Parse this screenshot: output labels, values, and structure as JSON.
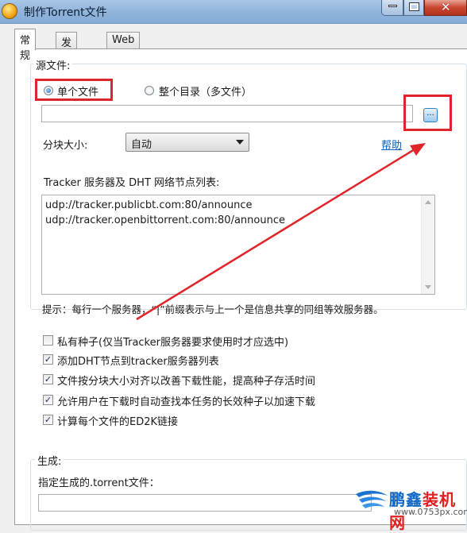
{
  "window": {
    "title": "制作Torrent文件",
    "controls": {
      "minimize": "—",
      "maximize": "□",
      "close": "✕"
    }
  },
  "tabs": [
    {
      "label": "常规",
      "active": true
    },
    {
      "label": "发布者",
      "active": false
    },
    {
      "label": "Web种子",
      "active": false
    }
  ],
  "source": {
    "group_label": "源文件:",
    "single_file_label": "单个文件",
    "single_file_selected": true,
    "directory_label": "整个目录（多文件）",
    "path_value": "",
    "browse_label": "..."
  },
  "piece_size": {
    "label": "分块大小:",
    "value": "自动",
    "help_link": "帮助"
  },
  "tracker": {
    "label": "Tracker 服务器及 DHT 网络节点列表:",
    "lines": [
      "udp://tracker.publicbt.com:80/announce",
      "udp://tracker.openbittorrent.com:80/announce"
    ],
    "hint": "提示：每行一个服务器，“|”前缀表示与上一个是信息共享的同组等效服务器。"
  },
  "options": [
    {
      "label": "私有种子(仅当Tracker服务器要求使用时才应选中)",
      "checked": false
    },
    {
      "label": "添加DHT节点到tracker服务器列表",
      "checked": true
    },
    {
      "label": "文件按分块大小对齐以改善下载性能，提高种子存活时间",
      "checked": true
    },
    {
      "label": "允许用户在下载时自动查找本任务的长效种子以加速下载",
      "checked": true
    },
    {
      "label": "计算每个文件的ED2K链接",
      "checked": true
    }
  ],
  "output": {
    "group_label": "生成:",
    "field_label": "指定生成的.torrent文件：",
    "path_value": ""
  },
  "watermark": {
    "brand_blue": "鹏鑫",
    "brand_red": "装机网",
    "url": "www.0753px.com"
  },
  "colors": {
    "annotation_red": "#e0252a",
    "link_blue": "#0b5fb8"
  }
}
